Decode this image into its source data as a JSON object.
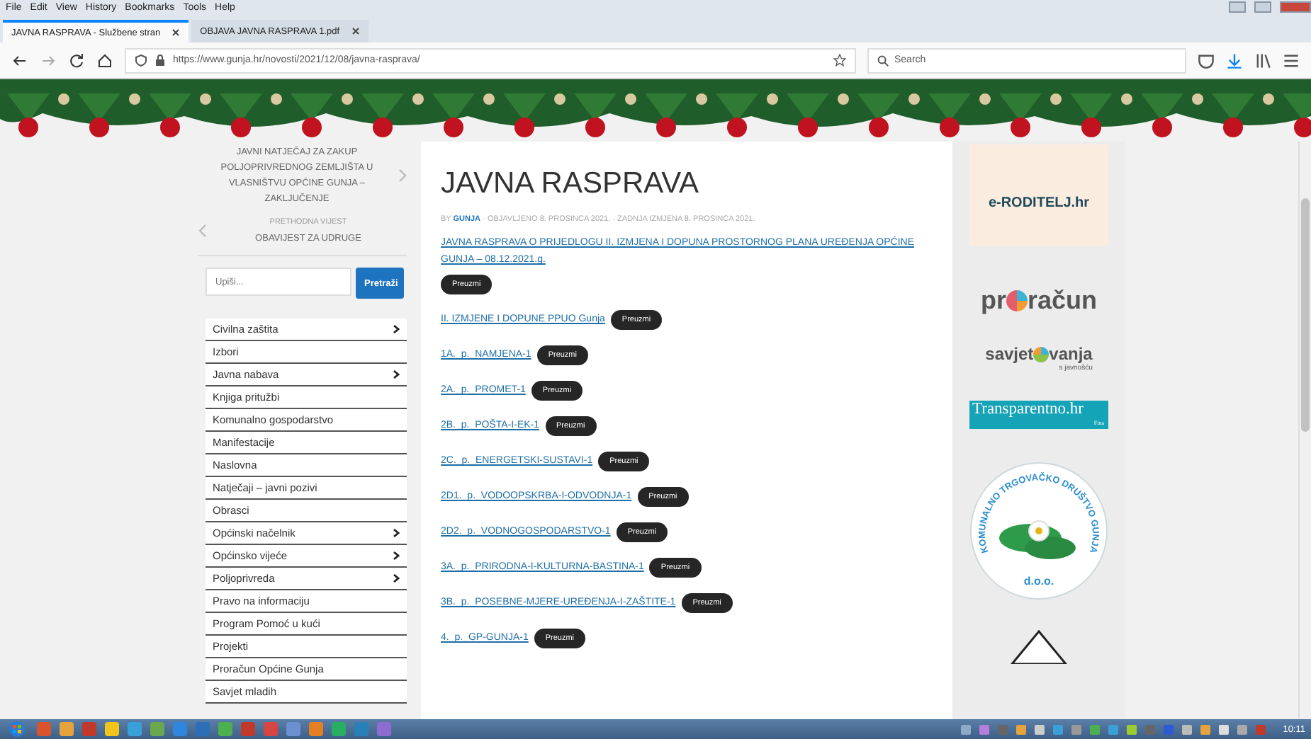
{
  "browser": {
    "menu": [
      "File",
      "Edit",
      "View",
      "History",
      "Bookmarks",
      "Tools",
      "Help"
    ],
    "tabs": [
      {
        "title": "JAVNA RASPRAVA - Službene stran",
        "selected": true
      },
      {
        "title": "OBJAVA JAVNA RASPRAVA 1.pdf",
        "selected": false
      }
    ],
    "url": "https://www.gunja.hr/novosti/2021/12/08/javna-rasprava/",
    "search": {
      "placeholder": "Search"
    }
  },
  "sidebar": {
    "post_nav": {
      "next_title": "JAVNI NATJEČAJ ZA ZAKUP POLJOPRIVREDNOG ZEMLJIŠTA U VLASNIŠTVU OPĆINE GUNJA – ZAKLJUČENJE",
      "previous_label": "PRETHODNA VIJEST",
      "previous_title": "OBAVIJEST ZA UDRUGE"
    },
    "search": {
      "placeholder": "Upiši...",
      "button": "Pretraži"
    },
    "menu": [
      {
        "label": "Civilna zaštita",
        "has_submenu": true
      },
      {
        "label": "Izbori",
        "has_submenu": false
      },
      {
        "label": "Javna nabava",
        "has_submenu": true
      },
      {
        "label": "Knjiga pritužbi",
        "has_submenu": false
      },
      {
        "label": "Komunalno gospodarstvo",
        "has_submenu": false
      },
      {
        "label": "Manifestacije",
        "has_submenu": false
      },
      {
        "label": "Naslovna",
        "has_submenu": false
      },
      {
        "label": "Natječaji – javni pozivi",
        "has_submenu": false
      },
      {
        "label": "Obrasci",
        "has_submenu": false
      },
      {
        "label": "Općinski načelnik",
        "has_submenu": true
      },
      {
        "label": "Općinsko vijeće",
        "has_submenu": true
      },
      {
        "label": "Poljoprivreda",
        "has_submenu": true
      },
      {
        "label": "Pravo na informaciju",
        "has_submenu": false
      },
      {
        "label": "Program Pomoć u kući",
        "has_submenu": false
      },
      {
        "label": "Projekti",
        "has_submenu": false
      },
      {
        "label": "Proračun Općine Gunja",
        "has_submenu": false
      },
      {
        "label": "Savjet mladih",
        "has_submenu": false
      }
    ]
  },
  "article": {
    "title": "JAVNA RASPRAVA",
    "meta_prefix": "BY",
    "author": "GUNJA",
    "meta_rest": "· OBJAVLJENO 8. PROSINCA 2021. · ZADNJA IZMJENA 8. PROSINCA 2021.",
    "documents": [
      {
        "title": "JAVNA RASPRAVA O PRIJEDLOGU II. IZMJENA I DOPUNA PROSTORNOG PLANA UREĐENJA OPĆINE GUNJA – 08.12.2021.g.",
        "button": "Preuzmi"
      },
      {
        "title": "II. IZMJENE I DOPUNE PPUO Gunja",
        "button": "Preuzmi"
      },
      {
        "title": "1A._p._NAMJENA-1",
        "button": "Preuzmi"
      },
      {
        "title": "2A._p._PROMET-1",
        "button": "Preuzmi"
      },
      {
        "title": "2B._p._POŠTA-I-EK-1",
        "button": "Preuzmi"
      },
      {
        "title": "2C._p._ENERGETSKI-SUSTAVI-1",
        "button": "Preuzmi"
      },
      {
        "title": "2D1._p._VODOOPSKRBA-I-ODVODNJA-1",
        "button": "Preuzmi"
      },
      {
        "title": "2D2._p._VODNOGOSPODARSTVO-1",
        "button": "Preuzmi"
      },
      {
        "title": "3A._p._PRIRODNA-I-KULTURNA-BASTINA-1",
        "button": "Preuzmi"
      },
      {
        "title": "3B._p._POSEBNE-MJERE-UREĐENJA-I-ZAŠTITE-1",
        "button": "Preuzmi"
      },
      {
        "title": "4._p._GP-GUNJA-1",
        "button": "Preuzmi"
      }
    ]
  },
  "partners": [
    {
      "kind": "eroditelj",
      "text": "e-RODITELJ.hr"
    },
    {
      "kind": "proracun",
      "before": "pr",
      "after": "račun"
    },
    {
      "kind": "savjetovanja",
      "before": "savjet",
      "after": "vanja",
      "sub": "s javnošću"
    },
    {
      "kind": "transparentno",
      "text": "Transparentno.hr",
      "sub": "Fina"
    },
    {
      "kind": "komunalno",
      "ring": "KOMUNALNO TRGOVAČKO DRUŠTVO GUNJA",
      "sub": "d.o.o."
    },
    {
      "kind": "triangle"
    }
  ],
  "taskbar": {
    "clock": "10:11"
  }
}
